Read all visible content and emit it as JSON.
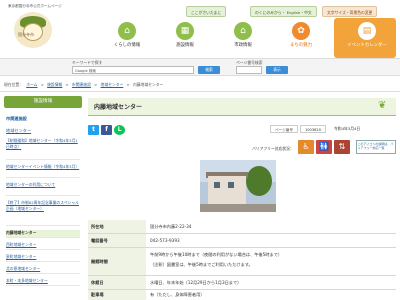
{
  "header": {
    "site_sub": "東京都国分寺市公式ホームページ",
    "site_name": "国分寺市",
    "links": [
      "ここがさいたまに",
      "のくにのみから・ English・中文",
      "文字サイズ・背景色の変更"
    ],
    "nav": [
      {
        "label": "くらしの情報",
        "icon": "home-icon"
      },
      {
        "label": "施設情報",
        "icon": "building-icon"
      },
      {
        "label": "市政情報",
        "icon": "city-hall-icon"
      },
      {
        "label": "まちの魅力",
        "icon": "flower-icon"
      },
      {
        "label": "イベントカレンダー",
        "icon": "calendar-icon"
      }
    ]
  },
  "search": {
    "kw_label": "キーワードで探す",
    "kw_placeholder": "Google 検索",
    "kw_button": "検索",
    "pn_label": "ページ番号検索",
    "pn_button": "表示"
  },
  "breadcrumb": [
    "現在位置：",
    "ホーム",
    ">",
    "施設情報",
    ">",
    "市関連施設",
    ">",
    "地域センター",
    ">",
    "内藤地域センター"
  ],
  "sidebar": {
    "head": "施設情報",
    "section1": "市関連施設",
    "section2": "地域センター",
    "items": [
      "【制限緩和】地域センター（令和4年3月1日時点）",
      "地域センターイベント情報（令和4年3月）",
      "地域センターの利用について",
      "【終了】市制62周年記念事業のスペシャル企画（地域センター）",
      "内藤地域センター",
      "西町地域センター",
      "泉町地域センター",
      "北の原地域センター",
      "本町・本多地域センター"
    ]
  },
  "main": {
    "title": "内藤地域センター",
    "page_no_label": "ページ番号",
    "page_no": "1003620",
    "updated": "令和4年3月4日",
    "barrier_free_label": "バリアフリー対応状況：",
    "barrier_free_info": "このアイコンの説明は、バリアフリー対応一覧",
    "rows": [
      {
        "label": "所在地",
        "value": "国分寺市内藤2-22-34"
      },
      {
        "label": "電話番号",
        "value": "042-573-9393"
      },
      {
        "label": "開館時間",
        "value": "午前9時から午後10時まで（夜間の利用がない場合は、午後5時まで）",
        "value2": "（注釈）図書室は、午後5時までご利用いただけます。"
      },
      {
        "label": "休館日",
        "value": "水曜日、年末年始（12月29日から1月3日まで）"
      },
      {
        "label": "駐車場",
        "value": "有（ただし、身体障害者用）"
      }
    ]
  },
  "colors": {
    "accent_green": "#77a53a",
    "nav_orange": "#f2a43a",
    "link_blue": "#2563a6"
  }
}
